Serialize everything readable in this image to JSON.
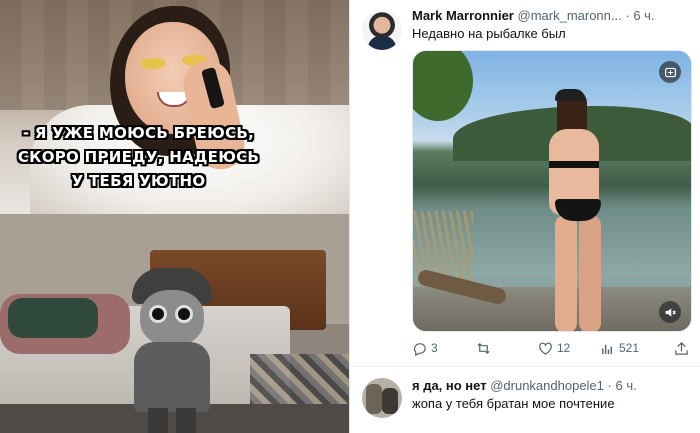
{
  "meme": {
    "caption_lines": [
      "- Я УЖЕ МОЮСЬ БРЕЮСЬ,",
      "СКОРО ПРИЕДУ, НАДЕЮСЬ",
      "У ТЕБЯ УЮТНО"
    ]
  },
  "tweet": {
    "author_name": "Mark Marronnier",
    "author_handle": "@mark_maronn...",
    "dot": "·",
    "time": "6 ч.",
    "text": "Недавно на рыбалке был",
    "media_icons": [
      "gif-badge-icon",
      "mute-icon"
    ],
    "stats": {
      "replies": "3",
      "retweets": "",
      "likes": "12",
      "views": "521"
    },
    "action_icons": [
      "reply-icon",
      "retweet-icon",
      "like-icon",
      "views-icon",
      "share-icon"
    ]
  },
  "reply": {
    "author_name": "я да, но нет",
    "author_handle": "@drunkandhopele1",
    "dot": "·",
    "time": "6 ч.",
    "text": "жопа у тебя братан мое почтение"
  },
  "colors": {
    "text_primary": "#0f1419",
    "text_secondary": "#536471",
    "border": "#eff3f4"
  }
}
